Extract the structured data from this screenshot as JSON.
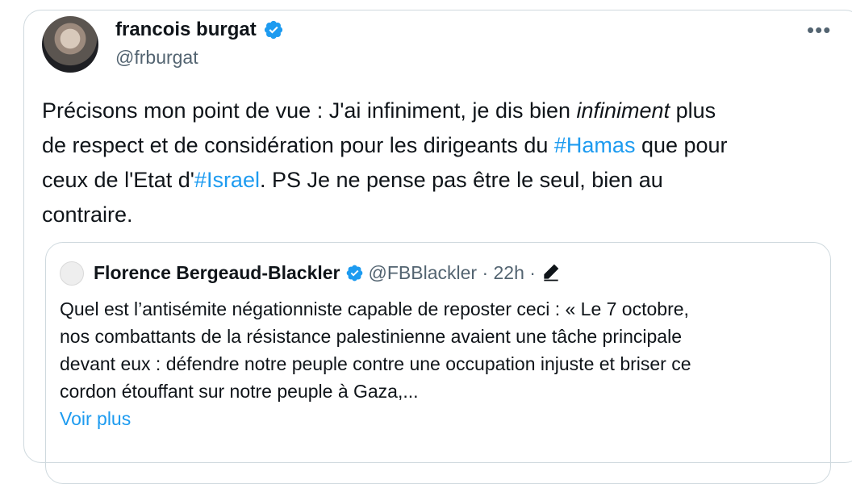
{
  "author": {
    "name": "francois burgat",
    "handle": "@frburgat"
  },
  "tweet": {
    "line1_a": "Précisons mon point de vue :  J'ai infiniment, je dis bien ",
    "line1_em": "infiniment",
    "line1_b": " plus",
    "line2_a": "de respect et de considération  pour les dirigeants du ",
    "tag_hamas": "#Hamas",
    "line2_b": " que pour",
    "line3_a": "ceux de l'Etat d'",
    "tag_israel": "#Israel",
    "line3_b": ".  PS Je ne pense pas être le seul, bien au",
    "line4": "contraire."
  },
  "quote": {
    "name": "Florence Bergeaud-Blackler",
    "meta": "@FBBlackler · 22h ·",
    "text_lines": [
      "Quel est l’antisémite négationniste capable de  reposter ceci : « Le 7 octobre,",
      "nos combattants de la résistance palestinienne avaient une tâche principale",
      "devant eux : défendre notre peuple contre une occupation injuste et briser ce",
      "cordon étouffant sur notre peuple à Gaza,..."
    ],
    "show_more": "Voir plus"
  },
  "icons": {
    "verified": "verified-badge-icon",
    "more": "more-options-icon",
    "edit": "edited-pencil-icon"
  },
  "colors": {
    "link": "#1d9bf0",
    "secondary_text": "#536471",
    "border": "#cfd9de"
  }
}
